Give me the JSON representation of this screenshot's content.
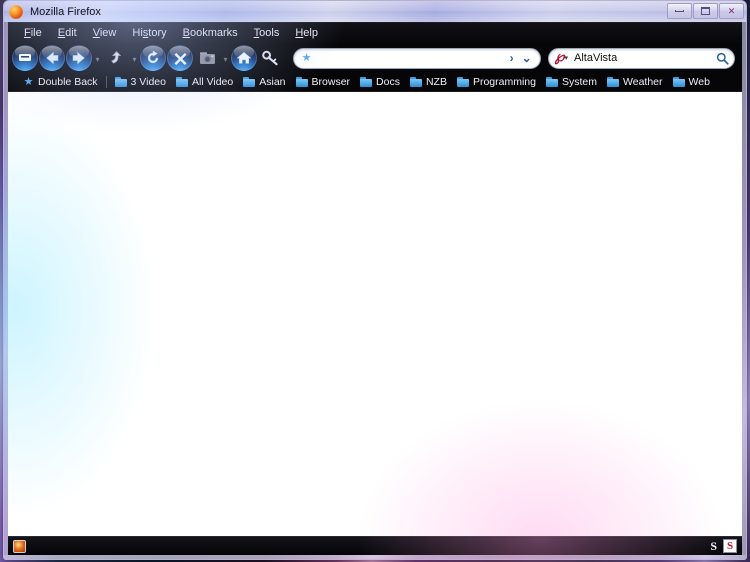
{
  "window": {
    "title": "Mozilla Firefox",
    "app_icon": "firefox-icon",
    "controls": {
      "minimize_label": "Minimize",
      "maximize_label": "Maximize",
      "close_label": "Close",
      "close_glyph": "✕"
    }
  },
  "menubar": {
    "items": [
      {
        "label": "File",
        "accel": "F"
      },
      {
        "label": "Edit",
        "accel": "E"
      },
      {
        "label": "View",
        "accel": "V"
      },
      {
        "label": "History",
        "accel": "s"
      },
      {
        "label": "Bookmarks",
        "accel": "B"
      },
      {
        "label": "Tools",
        "accel": "T"
      },
      {
        "label": "Help",
        "accel": "H"
      }
    ]
  },
  "toolbar": {
    "buttons": [
      {
        "name": "sidebar-panel-button",
        "icon": "panel-icon",
        "style": "orb",
        "label": "Sidebar"
      },
      {
        "name": "back-button",
        "icon": "back-arrow-icon",
        "style": "orb",
        "label": "Back"
      },
      {
        "name": "forward-button",
        "icon": "forward-arrow-icon",
        "style": "orb",
        "label": "Forward"
      },
      {
        "name": "up-button",
        "icon": "up-arrow-icon",
        "style": "flat",
        "label": "Up"
      },
      {
        "name": "reload-button",
        "icon": "reload-icon",
        "style": "orb",
        "label": "Reload"
      },
      {
        "name": "stop-button",
        "icon": "stop-x-icon",
        "style": "orb",
        "label": "Stop"
      },
      {
        "name": "screenshot-button",
        "icon": "camera-folder-icon",
        "style": "flat",
        "label": "Capture"
      },
      {
        "name": "home-button",
        "icon": "home-icon",
        "style": "orb",
        "label": "Home"
      },
      {
        "name": "key-button",
        "icon": "key-icon",
        "style": "flat",
        "label": "Passwords"
      }
    ]
  },
  "address_bar": {
    "name": "address-bar",
    "value": "",
    "placeholder": "",
    "star_icon": "bookmark-star-icon",
    "go_glyph": "›",
    "dropdown_glyph": "⌄"
  },
  "search_bar": {
    "name": "search-bar",
    "engine": "AltaVista",
    "engine_icon": "altavista-logo-icon",
    "engine_mark": "℘",
    "value": "AltaVista",
    "placeholder": "AltaVista",
    "dropdown_glyph": "▾",
    "search_icon": "magnifier-icon"
  },
  "bookmarks_toolbar": {
    "items": [
      {
        "label": "Double Back",
        "icon": "bookmark-star-icon",
        "type": "bookmark"
      },
      {
        "label": "3 Video",
        "icon": "folder-icon",
        "type": "folder"
      },
      {
        "label": "All Video",
        "icon": "folder-icon",
        "type": "folder"
      },
      {
        "label": "Asian",
        "icon": "folder-icon",
        "type": "folder"
      },
      {
        "label": "Browser",
        "icon": "folder-icon",
        "type": "folder"
      },
      {
        "label": "Docs",
        "icon": "folder-icon",
        "type": "folder"
      },
      {
        "label": "NZB",
        "icon": "folder-icon",
        "type": "folder"
      },
      {
        "label": "Programming",
        "icon": "folder-icon",
        "type": "folder"
      },
      {
        "label": "System",
        "icon": "folder-icon",
        "type": "folder"
      },
      {
        "label": "Weather",
        "icon": "folder-icon",
        "type": "folder"
      },
      {
        "label": "Web",
        "icon": "folder-icon",
        "type": "folder"
      }
    ]
  },
  "content": {
    "body_text": ""
  },
  "statusbar": {
    "left_icon": "firefox-status-icon",
    "text": "",
    "right_letter": "S",
    "right_boxed_letter": "S"
  },
  "colors": {
    "chrome_bg": "#060608",
    "chrome_text": "#f0f0f6",
    "titlebar_glass": "#bcc0e8",
    "orb_blue": "#2a86d6",
    "folder_blue": "#3f9fdd",
    "star_blue": "#59a8f0",
    "altavista_red": "#b21030",
    "content_bg": "#ffffff"
  }
}
